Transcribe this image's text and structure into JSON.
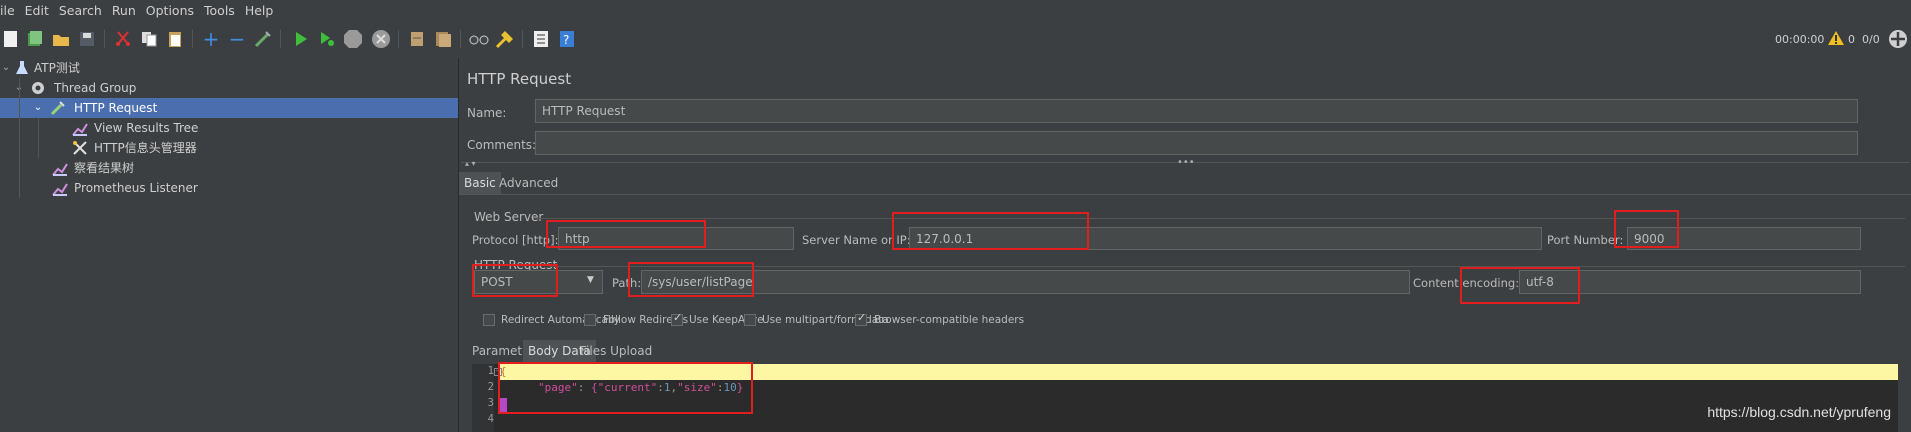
{
  "menu": [
    "ile",
    "Edit",
    "Search",
    "Run",
    "Options",
    "Tools",
    "Help"
  ],
  "toolbar": {
    "timer": "00:00:00",
    "warnings": "0",
    "threads": "0/0"
  },
  "tree": {
    "items": [
      {
        "label": "ATP测试",
        "icon": "test-plan-icon"
      },
      {
        "label": "Thread Group",
        "icon": "gear-icon"
      },
      {
        "label": "HTTP Request",
        "icon": "pipette-icon"
      },
      {
        "label": "View Results Tree",
        "icon": "chart-icon"
      },
      {
        "label": "HTTP信息头管理器",
        "icon": "tools-icon"
      },
      {
        "label": "察看结果树",
        "icon": "chart-icon"
      },
      {
        "label": "Prometheus Listener",
        "icon": "chart-icon"
      }
    ]
  },
  "panel": {
    "title": "HTTP Request",
    "name_label": "Name:",
    "name_value": "HTTP Request",
    "comments_label": "Comments:",
    "comments_value": "",
    "tabs": [
      "Basic",
      "Advanced"
    ],
    "web_server_title": "Web Server",
    "protocol_label": "Protocol [http]:",
    "protocol_value": "http",
    "server_label": "Server Name or IP:",
    "server_value": "127.0.0.1",
    "port_label": "Port Number:",
    "port_value": "9000",
    "http_request_title": "HTTP Request",
    "method_value": "POST",
    "path_label": "Path:",
    "path_value": "/sys/user/listPage",
    "encoding_label": "Content encoding:",
    "encoding_value": "utf-8",
    "checkboxes": [
      {
        "label": "Redirect Automatically",
        "checked": false
      },
      {
        "label": "Follow Redirects",
        "checked": false
      },
      {
        "label": "Use KeepAlive",
        "checked": true
      },
      {
        "label": "Use multipart/form-data",
        "checked": false
      },
      {
        "label": "Browser-compatible headers",
        "checked": true
      }
    ],
    "sub_tabs": [
      "Parameters",
      "Body Data",
      "Files Upload"
    ],
    "body_lines": [
      {
        "n": "1",
        "text": "{"
      },
      {
        "n": "2",
        "text_key": "\"page\"",
        "colon": ":",
        "brace_open": "{",
        "k1": "\"current\"",
        "c1": ":",
        "v1": "1",
        "comma": ",",
        "k2": "\"size\"",
        "c2": ":",
        "v2": "10",
        "brace_close": "}"
      },
      {
        "n": "3",
        "text": ""
      },
      {
        "n": "4",
        "text": ""
      }
    ]
  },
  "watermark": "https://blog.csdn.net/yprufeng"
}
